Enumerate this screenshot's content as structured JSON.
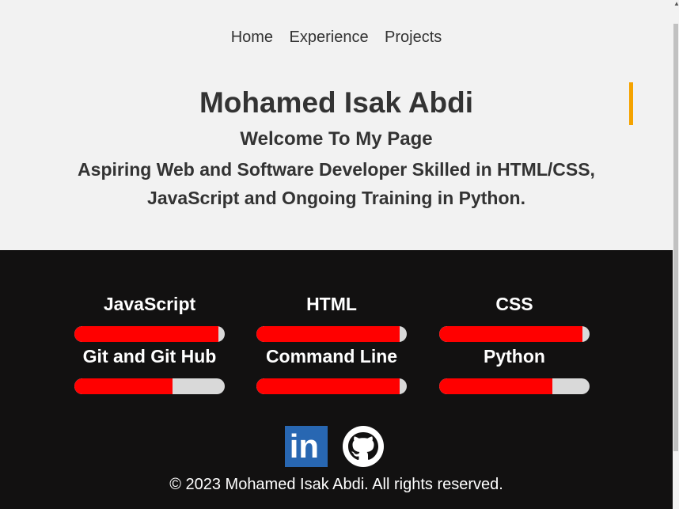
{
  "nav": {
    "items": [
      {
        "label": "Home"
      },
      {
        "label": "Experience"
      },
      {
        "label": "Projects"
      }
    ]
  },
  "hero": {
    "name": "Mohamed Isak Abdi",
    "welcome": "Welcome To My Page",
    "tagline": "Aspiring Web and Software Developer Skilled in HTML/CSS, JavaScript and Ongoing Training in Python."
  },
  "skills": [
    {
      "label": "JavaScript",
      "level": 0.96
    },
    {
      "label": "HTML",
      "level": 0.95
    },
    {
      "label": "CSS",
      "level": 0.95
    },
    {
      "label": "Git and Git Hub",
      "level": 0.65
    },
    {
      "label": "Command Line",
      "level": 0.95
    },
    {
      "label": "Python",
      "level": 0.75
    }
  ],
  "social": {
    "icons": [
      "linkedin-icon",
      "github-icon"
    ]
  },
  "footer": {
    "copyright": "© 2023 Mohamed Isak Abdi. All rights reserved."
  },
  "colors": {
    "accent": "#f5a300",
    "bar_fill": "#ff0000",
    "bar_track": "#d9d9d9",
    "dark_bg": "#121111",
    "light_bg": "#f2f2f2",
    "linkedin": "#2867b2"
  }
}
